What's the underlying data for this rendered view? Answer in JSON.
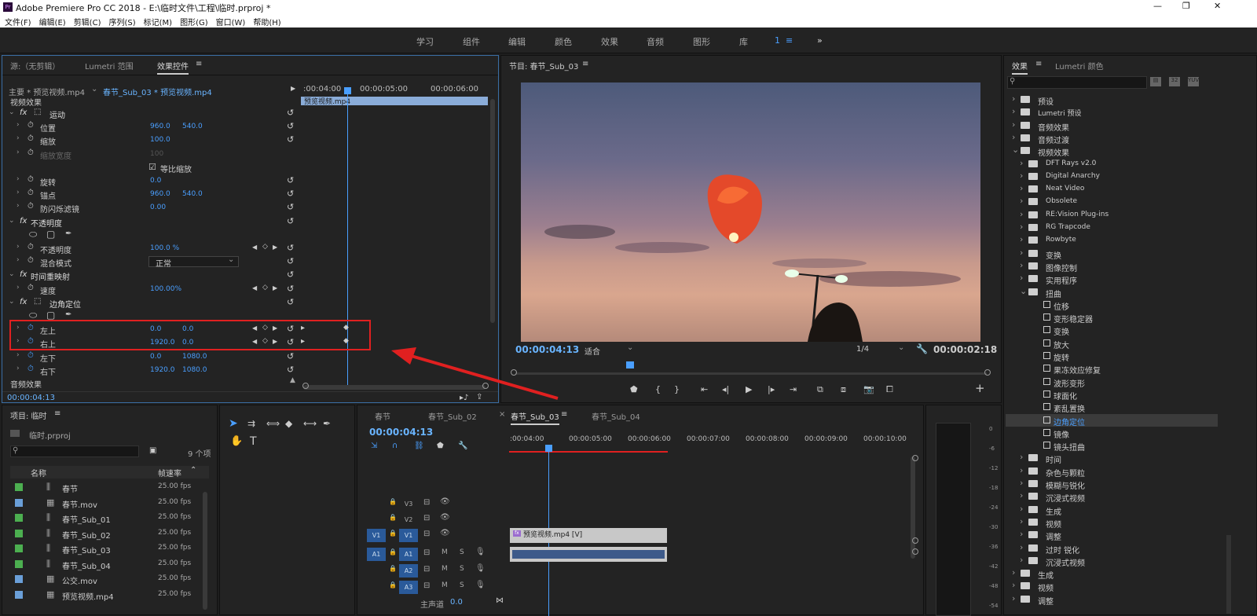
{
  "app": {
    "title": "Adobe Premiere Pro CC 2018 - E:\\临时文件\\工程\\临时.prproj *",
    "icon": "Pr",
    "min_icon": "—",
    "max_icon": "❐",
    "close_icon": "✕"
  },
  "menu": [
    "文件(F)",
    "编辑(E)",
    "剪辑(C)",
    "序列(S)",
    "标记(M)",
    "图形(G)",
    "窗口(W)",
    "帮助(H)"
  ],
  "workspaces": [
    "学习",
    "组件",
    "编辑",
    "颜色",
    "效果",
    "音频",
    "图形",
    "库"
  ],
  "ws_active": "1",
  "ws_menu": "≡",
  "ws_more": "»",
  "ec": {
    "tabs": {
      "source": "源:（无剪辑）",
      "lumetri": "Lumetri 范围",
      "effects": "效果控件",
      "menu": "≡"
    },
    "master": "主要 * 预览视频.mp4",
    "seq": "春节_Sub_03 * 预览视频.mp4",
    "ruler": [
      ":00:04:00",
      "00:00:05:00",
      "00:00:06:00"
    ],
    "clip": "预览视频.mp4",
    "video_fx": "视频效果",
    "audio_fx": "音频效果",
    "timecode": "00:00:04:13",
    "rows": [
      {
        "label": "运动",
        "fx": true
      },
      {
        "label": "位置",
        "v1": "960.0",
        "v2": "540.0"
      },
      {
        "label": "缩放",
        "v1": "100.0"
      },
      {
        "label": "缩放宽度",
        "v1": "100",
        "dim": true
      },
      {
        "label": "等比缩放",
        "check": true
      },
      {
        "label": "旋转",
        "v1": "0.0"
      },
      {
        "label": "锚点",
        "v1": "960.0",
        "v2": "540.0"
      },
      {
        "label": "防闪烁滤镜",
        "v1": "0.00"
      },
      {
        "label": "不透明度",
        "fx": true
      },
      {
        "label": "",
        "shapes": true
      },
      {
        "label": "不透明度",
        "v1": "100.0 %"
      },
      {
        "label": "混合模式",
        "select": "正常"
      },
      {
        "label": "时间重映射",
        "fx": true
      },
      {
        "label": "速度",
        "v1": "100.00%"
      },
      {
        "label": "边角定位",
        "fx": true
      },
      {
        "label": "",
        "shapes": true
      },
      {
        "label": "左上",
        "v1": "0.0",
        "v2": "0.0"
      },
      {
        "label": "右上",
        "v1": "1920.0",
        "v2": "0.0"
      },
      {
        "label": "左下",
        "v1": "0.0",
        "v2": "1080.0"
      },
      {
        "label": "右下",
        "v1": "1920.0",
        "v2": "1080.0"
      }
    ]
  },
  "program": {
    "title": "节目: 春节_Sub_03",
    "menu": "≡",
    "timecode": "00:00:04:13",
    "fit": "适合",
    "res": "1/4",
    "duration": "00:00:02:18"
  },
  "effects": {
    "tabs": {
      "effects": "效果",
      "lumetri": "Lumetri 颜色",
      "menu": "≡"
    },
    "items": [
      {
        "l": "预设",
        "d": 0,
        "t": "f"
      },
      {
        "l": "Lumetri 预设",
        "d": 0,
        "t": "f"
      },
      {
        "l": "音频效果",
        "d": 0,
        "t": "f"
      },
      {
        "l": "音频过渡",
        "d": 0,
        "t": "f"
      },
      {
        "l": "视频效果",
        "d": 0,
        "t": "f",
        "open": true
      },
      {
        "l": "DFT Rays v2.0",
        "d": 1,
        "t": "f"
      },
      {
        "l": "Digital Anarchy",
        "d": 1,
        "t": "f"
      },
      {
        "l": "Neat Video",
        "d": 1,
        "t": "f"
      },
      {
        "l": "Obsolete",
        "d": 1,
        "t": "f"
      },
      {
        "l": "RE:Vision Plug-ins",
        "d": 1,
        "t": "f"
      },
      {
        "l": "RG Trapcode",
        "d": 1,
        "t": "f"
      },
      {
        "l": "Rowbyte",
        "d": 1,
        "t": "f"
      },
      {
        "l": "变换",
        "d": 1,
        "t": "f"
      },
      {
        "l": "图像控制",
        "d": 1,
        "t": "f"
      },
      {
        "l": "实用程序",
        "d": 1,
        "t": "f"
      },
      {
        "l": "扭曲",
        "d": 1,
        "t": "f",
        "open": true
      },
      {
        "l": "位移",
        "d": 2,
        "t": "e"
      },
      {
        "l": "变形稳定器",
        "d": 2,
        "t": "e"
      },
      {
        "l": "变换",
        "d": 2,
        "t": "e"
      },
      {
        "l": "放大",
        "d": 2,
        "t": "e"
      },
      {
        "l": "旋转",
        "d": 2,
        "t": "e"
      },
      {
        "l": "果冻效应修复",
        "d": 2,
        "t": "e"
      },
      {
        "l": "波形变形",
        "d": 2,
        "t": "e"
      },
      {
        "l": "球面化",
        "d": 2,
        "t": "e"
      },
      {
        "l": "紊乱置换",
        "d": 2,
        "t": "e"
      },
      {
        "l": "边角定位",
        "d": 2,
        "t": "e",
        "sel": true
      },
      {
        "l": "镜像",
        "d": 2,
        "t": "e"
      },
      {
        "l": "镜头扭曲",
        "d": 2,
        "t": "e"
      },
      {
        "l": "时间",
        "d": 1,
        "t": "f"
      },
      {
        "l": "杂色与颗粒",
        "d": 1,
        "t": "f"
      },
      {
        "l": "模糊与锐化",
        "d": 1,
        "t": "f"
      },
      {
        "l": "沉浸式视频",
        "d": 1,
        "t": "f"
      },
      {
        "l": "生成",
        "d": 1,
        "t": "f"
      },
      {
        "l": "视频",
        "d": 1,
        "t": "f"
      },
      {
        "l": "调整",
        "d": 1,
        "t": "f"
      },
      {
        "l": "过时 锐化",
        "d": 1,
        "t": "f"
      },
      {
        "l": "沉浸式视频",
        "d": 1,
        "t": "f"
      },
      {
        "l": "生成",
        "d": 0,
        "t": "f"
      },
      {
        "l": "视频",
        "d": 0,
        "t": "f"
      },
      {
        "l": "调整",
        "d": 0,
        "t": "f"
      }
    ]
  },
  "project": {
    "title": "项目: 临时",
    "menu": "≡",
    "file": "临时.prproj",
    "count": "9 个项",
    "cols": {
      "name": "名称",
      "fps": "帧速率"
    },
    "items": [
      {
        "name": "春节",
        "fps": "25.00 fps",
        "color": "#4caf50",
        "kind": "seq"
      },
      {
        "name": "春节.mov",
        "fps": "25.00 fps",
        "color": "#6a9fd8",
        "kind": "clip"
      },
      {
        "name": "春节_Sub_01",
        "fps": "25.00 fps",
        "color": "#4caf50",
        "kind": "seq"
      },
      {
        "name": "春节_Sub_02",
        "fps": "25.00 fps",
        "color": "#4caf50",
        "kind": "seq"
      },
      {
        "name": "春节_Sub_03",
        "fps": "25.00 fps",
        "color": "#4caf50",
        "kind": "seq"
      },
      {
        "name": "春节_Sub_04",
        "fps": "25.00 fps",
        "color": "#4caf50",
        "kind": "seq"
      },
      {
        "name": "公交.mov",
        "fps": "25.00 fps",
        "color": "#6a9fd8",
        "kind": "clip"
      },
      {
        "name": "预览视频.mp4",
        "fps": "25.00 fps",
        "color": "#6a9fd8",
        "kind": "clip"
      }
    ]
  },
  "timeline": {
    "tabs": [
      "春节",
      "春节_Sub_02",
      "春节_Sub_03",
      "春节_Sub_04"
    ],
    "close": "×",
    "menu": "≡",
    "timecode": "00:00:04:13",
    "ruler": [
      ":00:04:00",
      "00:00:05:00",
      "00:00:06:00",
      "00:00:07:00",
      "00:00:08:00",
      "00:00:09:00",
      "00:00:10:00"
    ],
    "tracks": [
      "V3",
      "V2",
      "V1",
      "A1",
      "A2",
      "A3"
    ],
    "src_v": "V1",
    "src_a": "A1",
    "clip_v": "预览视频.mp4 [V]",
    "master": "主声道",
    "master_val": "0.0",
    "meter": [
      "0",
      "-6",
      "-12",
      "-18",
      "-24",
      "-30",
      "-36",
      "-42",
      "-48",
      "-54"
    ]
  }
}
